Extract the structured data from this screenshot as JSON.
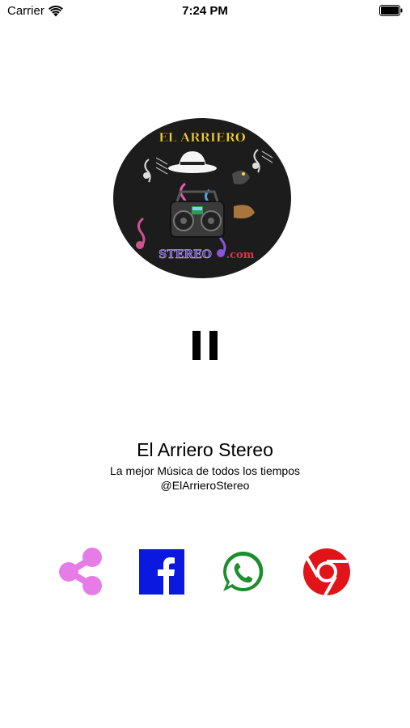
{
  "status_bar": {
    "carrier": "Carrier",
    "time": "7:24 PM"
  },
  "logo": {
    "text_top": "EL ARRIERO",
    "text_bottom": "STEREO",
    "text_domain": ".com",
    "background_color": "#1c1c1c",
    "title_color": "#f2d02a",
    "bottom_color": "#5b3fb5",
    "domain_color": "#e0304a"
  },
  "player": {
    "state": "playing",
    "control_icon": "pause-icon"
  },
  "station": {
    "title": "El Arriero Stereo",
    "subtitle": "La mejor Música de todos los tiempos",
    "handle": "@ElArrieroStereo"
  },
  "share_buttons": [
    {
      "icon": "share-icon",
      "color": "#e67ce8"
    },
    {
      "icon": "facebook-icon",
      "color": "#0a18e0"
    },
    {
      "icon": "whatsapp-icon",
      "color": "#1b8f2c"
    },
    {
      "icon": "chrome-icon",
      "color": "#e2141a"
    }
  ]
}
